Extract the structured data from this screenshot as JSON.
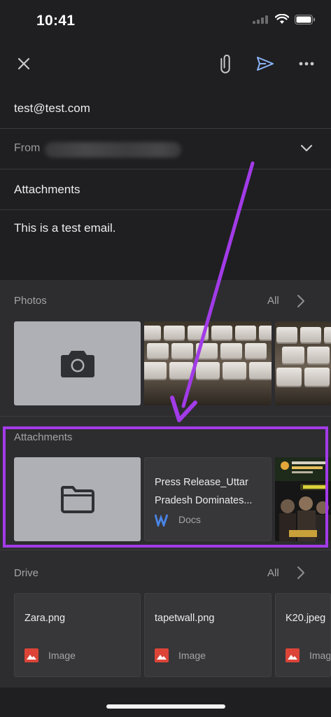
{
  "status_bar": {
    "time": "10:41"
  },
  "toolbar": {
    "close_icon": "close-icon",
    "attach_icon": "paperclip-icon",
    "send_icon": "send-icon",
    "more_icon": "more-horizontal-icon",
    "send_color": "#8ab4f8"
  },
  "compose": {
    "to": "test@test.com",
    "from_label": "From",
    "subject": "Attachments",
    "body": "This is a test email."
  },
  "photos": {
    "label": "Photos",
    "all_label": "All"
  },
  "attachments": {
    "label": "Attachments",
    "doc_title_line1": "Press Release_Uttar",
    "doc_title_line2": "Pradesh Dominates...",
    "doc_type": "Docs",
    "doc_icon_color": "#4a86e8"
  },
  "drive": {
    "label": "Drive",
    "all_label": "All",
    "files": [
      {
        "name": "Zara.png",
        "type": "Image"
      },
      {
        "name": "tapetwall.png",
        "type": "Image"
      },
      {
        "name": "K20.jpeg",
        "type": "Image"
      }
    ],
    "image_icon_color": "#db4437"
  },
  "annotation": {
    "color": "#a23be8"
  }
}
